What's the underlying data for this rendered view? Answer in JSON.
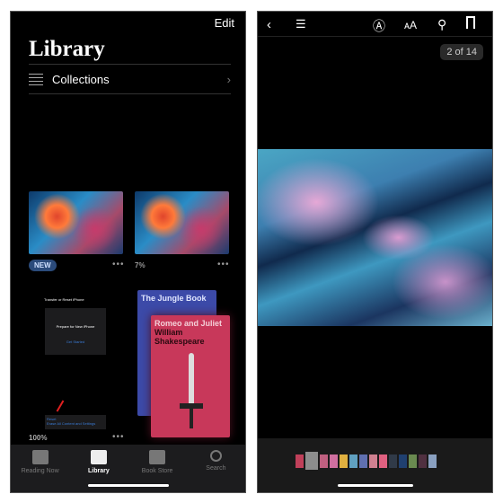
{
  "library": {
    "edit": "Edit",
    "title": "Library",
    "collections": "Collections",
    "books": [
      {
        "badge": "NEW"
      },
      {
        "progress": "7%"
      },
      {
        "progress": "100%"
      }
    ],
    "phone_screen": {
      "header": "Transfer or Reset iPhone",
      "card_title": "Prepare for New iPhone",
      "card_link": "Get Started",
      "reset": "Reset",
      "erase": "Erase All Content and Settings"
    },
    "jungle_book": "The Jungle Book",
    "romeo": {
      "title": "Romeo and Juliet",
      "author": "William Shakespeare"
    },
    "tabs": [
      {
        "label": "Reading Now",
        "active": false
      },
      {
        "label": "Library",
        "active": true
      },
      {
        "label": "Book Store",
        "active": false
      },
      {
        "label": "Search",
        "active": false
      }
    ]
  },
  "reader": {
    "page_indicator": "2 of 14",
    "thumbnail_colors": [
      "#c0405a",
      "#999",
      "#c06080",
      "#d070a0",
      "#e0b040",
      "#60a0c0",
      "#6070b0",
      "#d08090",
      "#e06080",
      "#303a48",
      "#204070",
      "#6a8a50",
      "#503040",
      "#8aa0c0"
    ]
  }
}
